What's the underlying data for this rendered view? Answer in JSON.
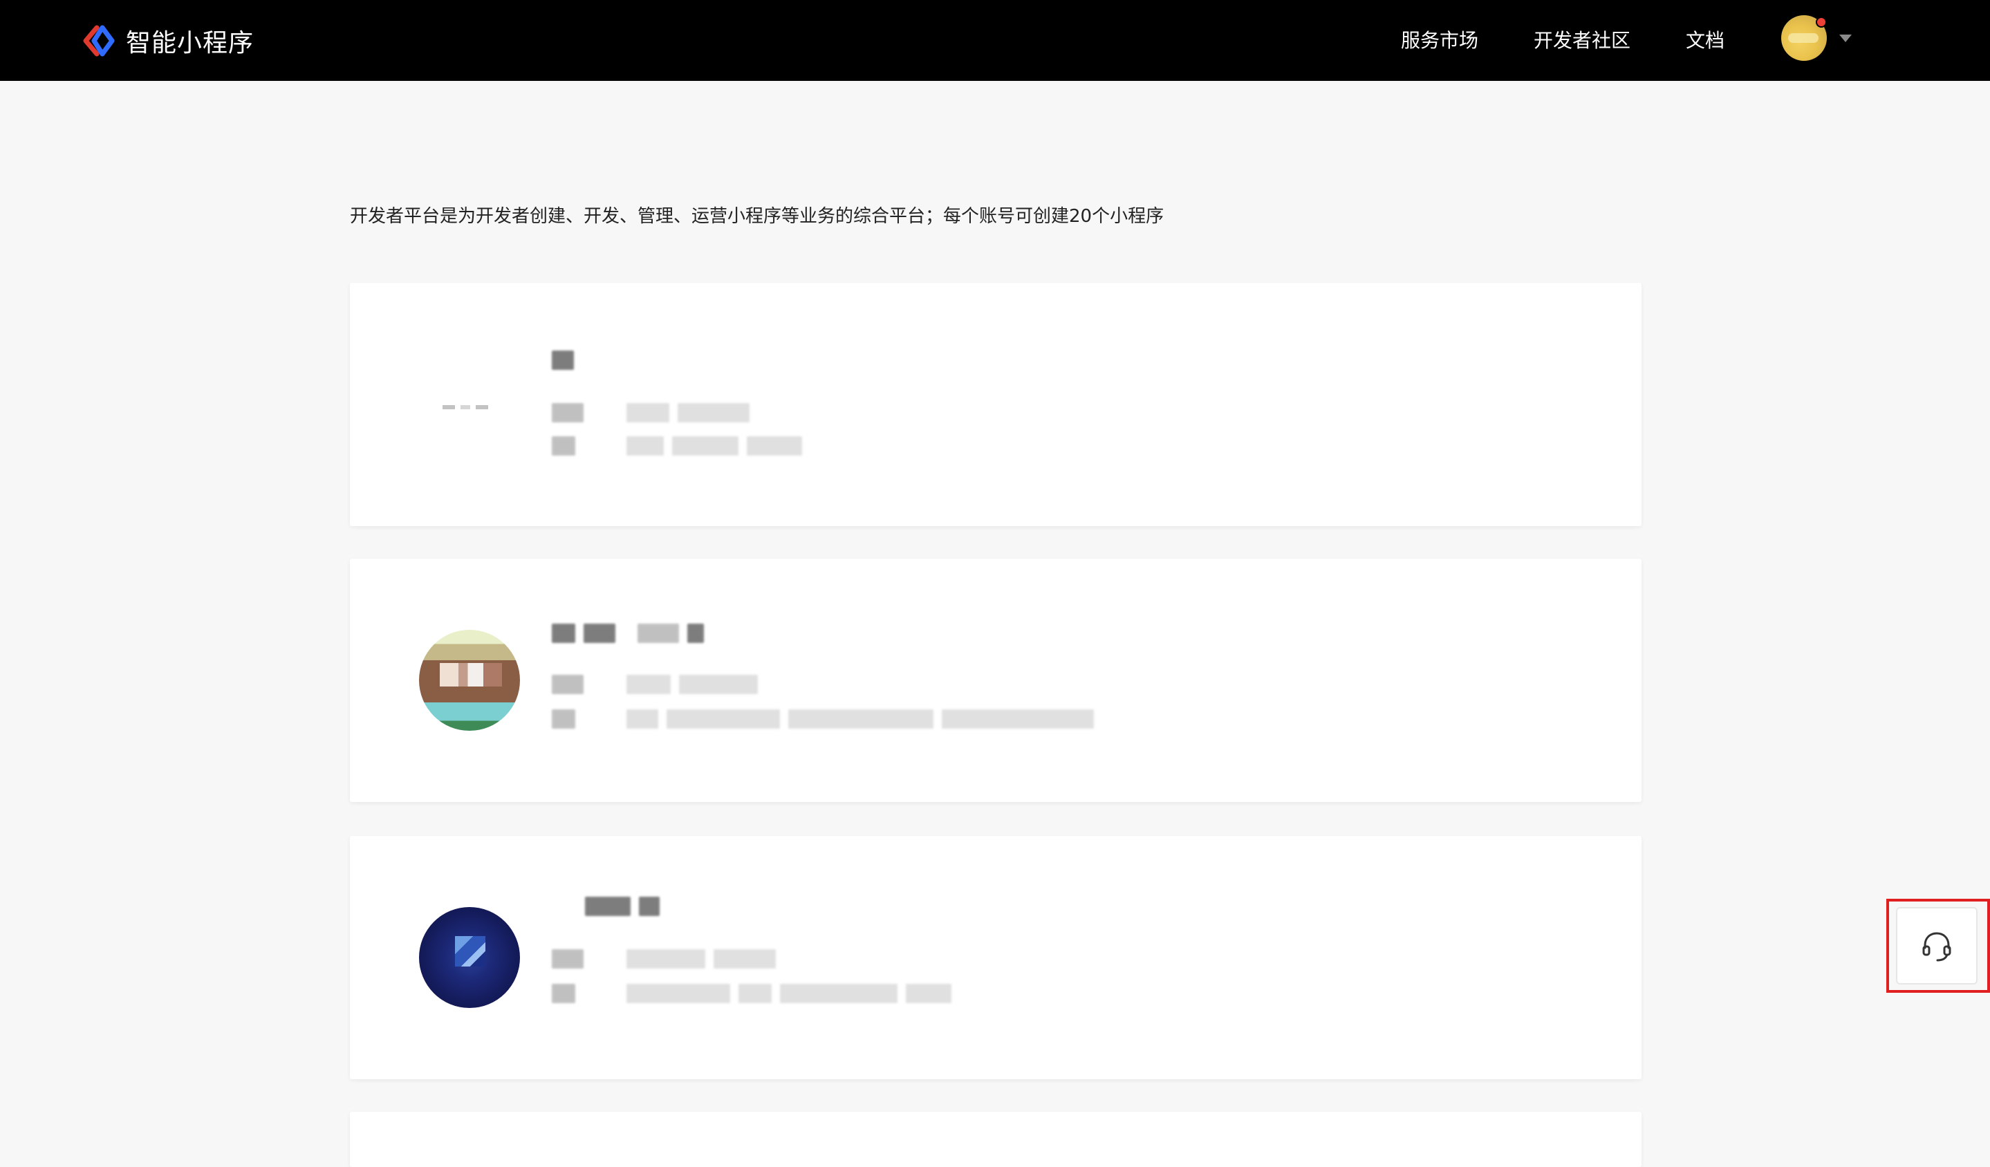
{
  "header": {
    "brand_name": "智能小程序",
    "nav": {
      "market": "服务市场",
      "community": "开发者社区",
      "docs": "文档"
    }
  },
  "intro": {
    "text": "开发者平台是为开发者创建、开发、管理、运营小程序等业务的综合平台；每个账号可创建20个小程序"
  },
  "apps": [
    {
      "icon": "blank-icon"
    },
    {
      "icon": "app-pixel-icon-2"
    },
    {
      "icon": "app-pixel-icon-3"
    }
  ],
  "floating": {
    "support_icon": "headset-icon"
  },
  "colors": {
    "header_bg": "#000000",
    "page_bg": "#f7f7f7",
    "highlight_border": "#e02020",
    "logo_red": "#e03a2e",
    "logo_blue": "#2f6bff"
  }
}
